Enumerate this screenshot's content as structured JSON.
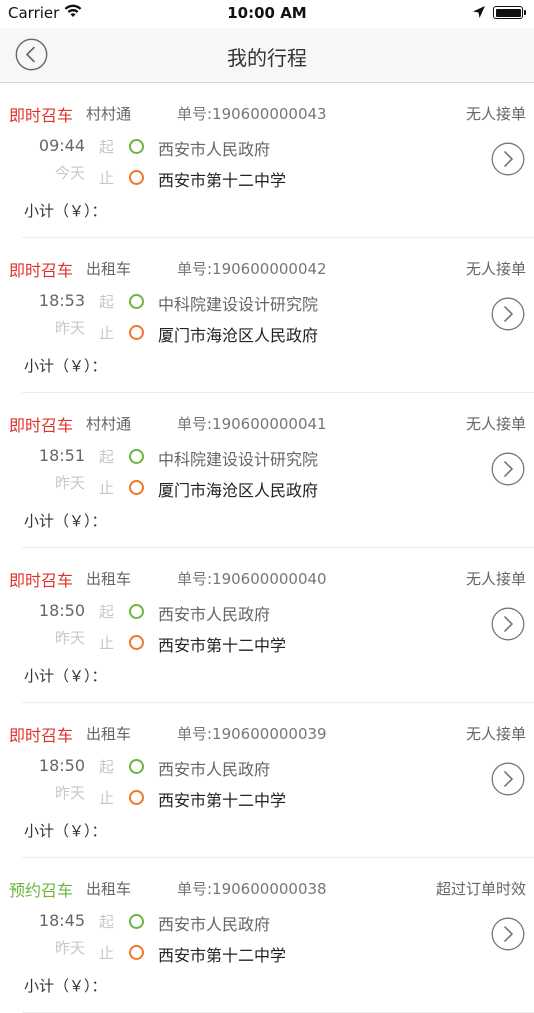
{
  "status_bar": {
    "carrier": "Carrier",
    "time": "10:00 AM"
  },
  "nav": {
    "title": "我的行程"
  },
  "colors": {
    "instant": "#e0322c",
    "reserve": "#6db33f",
    "start_dot": "#6db33f",
    "end_dot": "#f0772a"
  },
  "labels": {
    "start": "起",
    "end": "止",
    "subtotal": "小计（￥）："
  },
  "trips": [
    {
      "type": "即时召车",
      "type_color": "#e0322c",
      "vehicle": "村村通",
      "order": "单号:190600000043",
      "status": "无人接单",
      "time": "09:44",
      "day": "今天",
      "from": "西安市人民政府",
      "to": "西安市第十二中学"
    },
    {
      "type": "即时召车",
      "type_color": "#e0322c",
      "vehicle": "出租车",
      "order": "单号:190600000042",
      "status": "无人接单",
      "time": "18:53",
      "day": "昨天",
      "from": "中科院建设设计研究院",
      "to": "厦门市海沧区人民政府"
    },
    {
      "type": "即时召车",
      "type_color": "#e0322c",
      "vehicle": "村村通",
      "order": "单号:190600000041",
      "status": "无人接单",
      "time": "18:51",
      "day": "昨天",
      "from": "中科院建设设计研究院",
      "to": "厦门市海沧区人民政府"
    },
    {
      "type": "即时召车",
      "type_color": "#e0322c",
      "vehicle": "出租车",
      "order": "单号:190600000040",
      "status": "无人接单",
      "time": "18:50",
      "day": "昨天",
      "from": "西安市人民政府",
      "to": "西安市第十二中学"
    },
    {
      "type": "即时召车",
      "type_color": "#e0322c",
      "vehicle": "出租车",
      "order": "单号:190600000039",
      "status": "无人接单",
      "time": "18:50",
      "day": "昨天",
      "from": "西安市人民政府",
      "to": "西安市第十二中学"
    },
    {
      "type": "预约召车",
      "type_color": "#6db33f",
      "vehicle": "出租车",
      "order": "单号:190600000038",
      "status": "超过订单时效",
      "time": "18:45",
      "day": "昨天",
      "from": "西安市人民政府",
      "to": "西安市第十二中学"
    }
  ]
}
